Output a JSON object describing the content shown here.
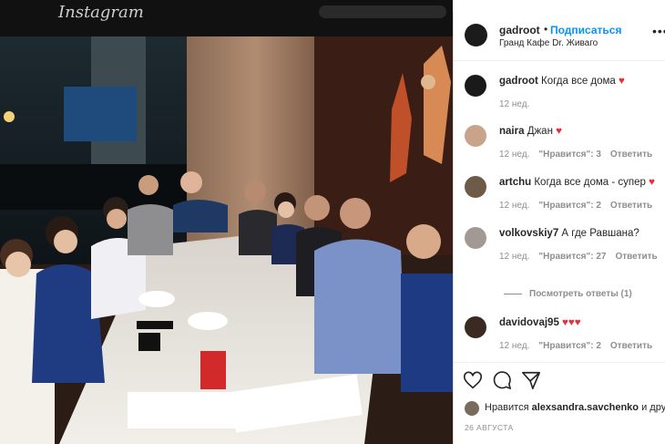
{
  "topbar": {
    "brand": "Instagram"
  },
  "post": {
    "author": "gadroot",
    "dot": "•",
    "follow_label": "Подписаться",
    "location": "Гранд Кафе Dr. Живаго",
    "more_label": "•••"
  },
  "comments": [
    {
      "username": "gadroot",
      "text": "Когда все дома",
      "emoji": "♥",
      "time": "12 нед.",
      "likes": "",
      "reply": "",
      "avatar_color": "#1a1a1a"
    },
    {
      "username": "naira",
      "text": "Джан",
      "emoji": "♥",
      "time": "12 нед.",
      "likes": "\"Нравится\": 3",
      "reply": "Ответить",
      "avatar_color": "#c9a48a"
    },
    {
      "username": "artchu",
      "text": "Когда все дома - супер",
      "emoji": "♥",
      "time": "12 нед.",
      "likes": "\"Нравится\": 2",
      "reply": "Ответить",
      "avatar_color": "#6e5a48"
    },
    {
      "username": "volkovskiy7",
      "text": "А где Равшана?",
      "emoji": "",
      "time": "12 нед.",
      "likes": "\"Нравится\": 27",
      "reply": "Ответить",
      "avatar_color": "#a29a92"
    },
    {
      "username": "davidovaj95",
      "text": "",
      "emoji": "♥♥♥",
      "time": "12 нед.",
      "likes": "\"Нравится\": 2",
      "reply": "Ответить",
      "avatar_color": "#3a2a22"
    }
  ],
  "view_replies": "Посмотреть ответы (1)",
  "actions": {
    "like_icon": "heart-outline-icon",
    "comment_icon": "comment-icon",
    "share_icon": "paper-plane-icon"
  },
  "likes": {
    "prefix": "Нравится",
    "user": "alexsandra.savchenko",
    "suffix": "и дру"
  },
  "date": "26 АВГУСТА",
  "colors": {
    "link": "#0095f6",
    "muted": "#8e8e8e",
    "heart": "#ed2a35"
  }
}
